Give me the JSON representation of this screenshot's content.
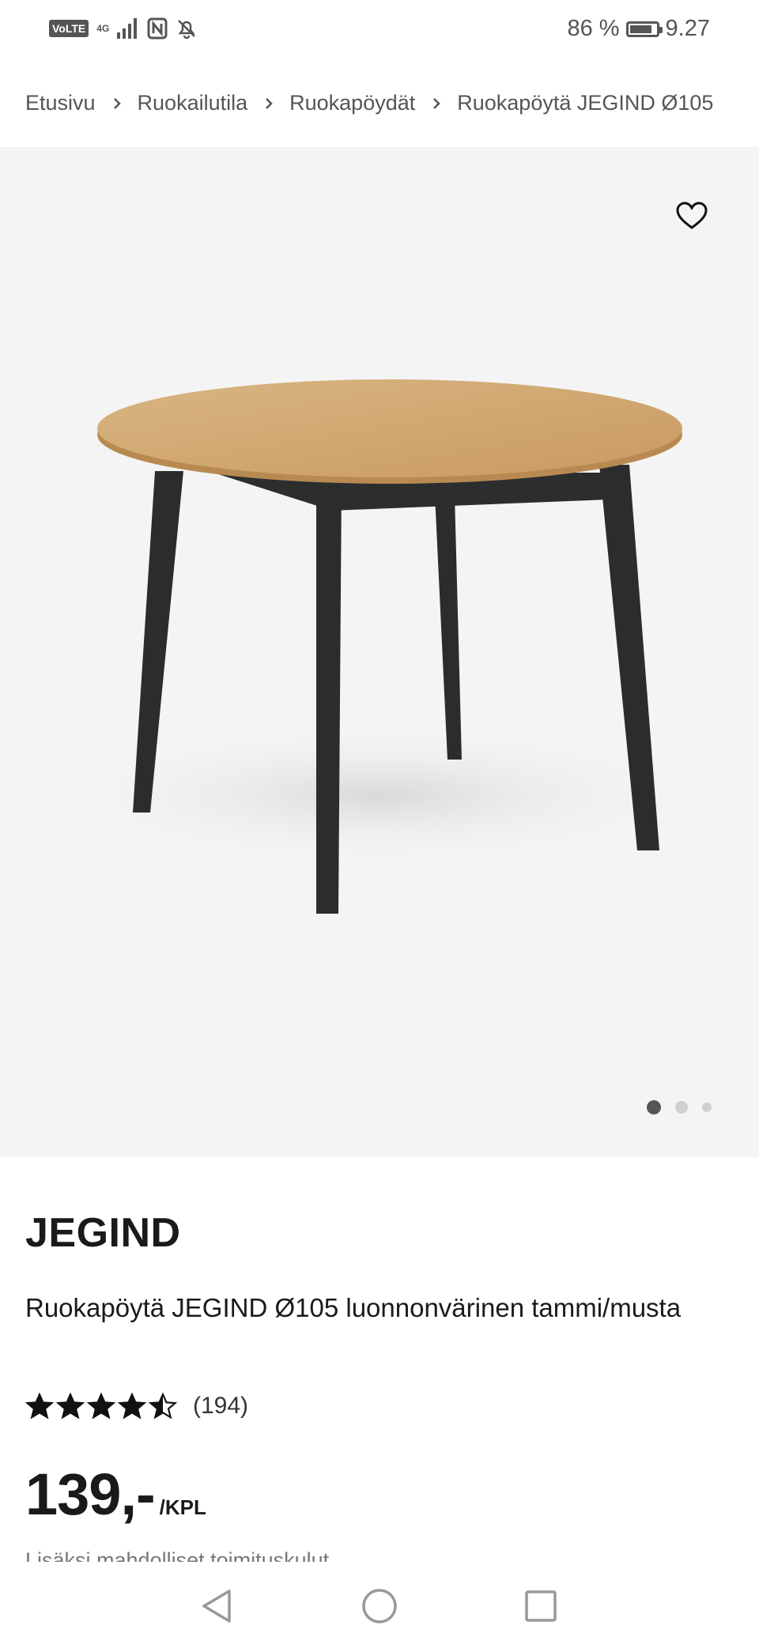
{
  "status_bar": {
    "volte": "VoLTE",
    "network": "4G",
    "battery_percent_text": "86 %",
    "battery_level": 0.86,
    "time": "9.27"
  },
  "breadcrumb": [
    {
      "label": "Etusivu"
    },
    {
      "label": "Ruokailutila"
    },
    {
      "label": "Ruokapöydät"
    },
    {
      "label": "Ruokapöytä JEGIND Ø105"
    }
  ],
  "gallery": {
    "image_count": 3,
    "active_index": 0
  },
  "product": {
    "brand": "JEGIND",
    "name": "Ruokapöytä JEGIND Ø105 luonnonvärinen tammi/musta",
    "rating_value": 4.5,
    "rating_max": 5,
    "review_count": "(194)",
    "price": "139,-",
    "price_unit": "/KPL",
    "note": "Lisäksi mahdolliset toimituskulut"
  },
  "colors": {
    "background": "#ffffff",
    "hero_background": "#f4f4f4",
    "text": "#1a1a1a",
    "muted": "#555555"
  },
  "icons": {
    "favorite": "heart-icon",
    "breadcrumb_separator": "chevron-right-icon",
    "nav_back": "triangle-back-icon",
    "nav_home": "circle-home-icon",
    "nav_recent": "square-recent-icon"
  }
}
